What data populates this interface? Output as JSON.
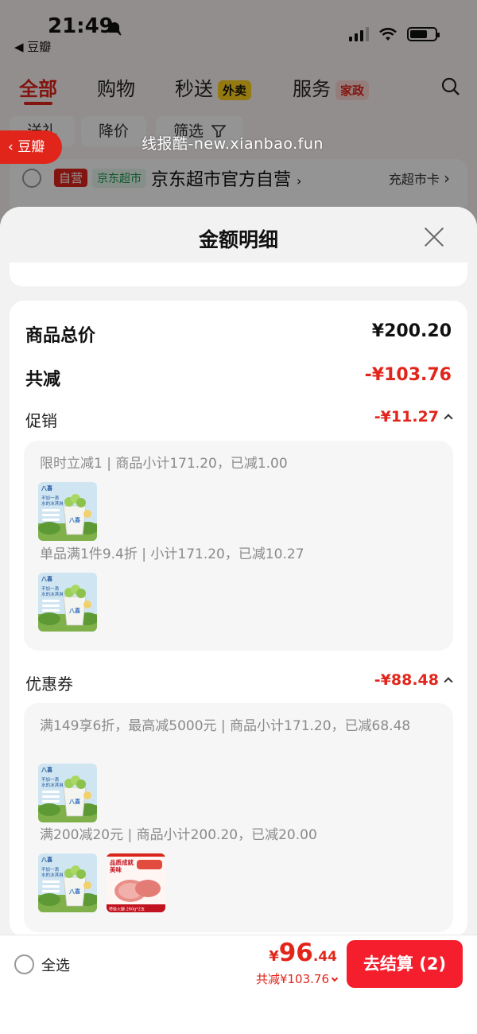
{
  "status_bar": {
    "time": "21:49",
    "back_app": "◀ 豆瓣"
  },
  "top_tabs": [
    {
      "label": "全部"
    },
    {
      "label": "购物"
    },
    {
      "label": "秒送",
      "badge": "外卖"
    },
    {
      "label": "服务",
      "badge": "家政"
    }
  ],
  "filters": [
    "送礼",
    "降价",
    "筛选"
  ],
  "side_back": "豆瓣",
  "watermark": "线报酷-new.xianbao.fun",
  "store": {
    "tag_self": "自营",
    "tag_market": "京东超市",
    "name": "京东超市官方自营",
    "card_link": "充超市卡"
  },
  "sheet": {
    "title": "金额明细",
    "goods_total_label": "商品总价",
    "goods_total_value": "¥200.20",
    "total_reduce_label": "共减",
    "total_reduce_value": "-¥103.76",
    "promo": {
      "label": "促销",
      "value": "-¥11.27",
      "items": [
        {
          "text": "限时立减1 | 商品小计171.20，已减1.00"
        },
        {
          "text": "单品满1件9.4折 | 小计171.20，已减10.27"
        }
      ]
    },
    "coupon": {
      "label": "优惠券",
      "value": "-¥88.48",
      "items": [
        {
          "text": "满149享6折，最高减5000元 | 商品小计171.20，已减68.48"
        },
        {
          "text": "满200减20元 | 商品小计200.20，已减20.00"
        }
      ]
    },
    "product_thumbs": {
      "yogurt_brand": "八喜",
      "yogurt_text": "不加一滴水的冰淇淋",
      "ham_title": "品质成就美味",
      "ham_subtitle": "特级火腿 260g*2支"
    }
  },
  "bottom_bar": {
    "select_all": "全选",
    "currency": "¥",
    "total_int": "96",
    "total_dec": ".44",
    "savings": "共减¥103.76",
    "checkout": "去结算 (2)"
  },
  "colors": {
    "accent_red": "#e1251b",
    "button_red": "#f41e2c",
    "sheet_bg": "#f2f2f2"
  },
  "icons": [
    "mute-bell-icon",
    "signal-icon",
    "wifi-icon",
    "battery-icon",
    "search-icon",
    "filter-icon",
    "close-icon",
    "chevron-right-icon",
    "chevron-up-icon",
    "chevron-down-icon"
  ]
}
